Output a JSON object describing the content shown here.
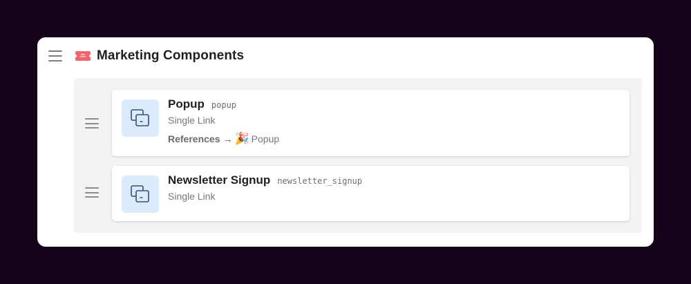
{
  "section": {
    "icon": "ticket-icon",
    "title": "Marketing Components"
  },
  "components": [
    {
      "name": "Popup",
      "key": "popup",
      "type": "Single Link",
      "icon": "component-icon",
      "references": {
        "label": "References",
        "arrow": "→",
        "emoji": "🎉",
        "target": "Popup"
      }
    },
    {
      "name": "Newsletter Signup",
      "key": "newsletter_signup",
      "type": "Single Link",
      "icon": "component-icon"
    }
  ]
}
